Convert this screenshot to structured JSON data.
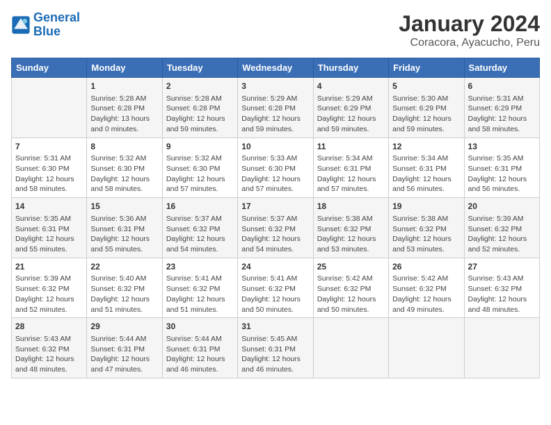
{
  "logo": {
    "text_general": "General",
    "text_blue": "Blue"
  },
  "title": "January 2024",
  "subtitle": "Coracora, Ayacucho, Peru",
  "days_of_week": [
    "Sunday",
    "Monday",
    "Tuesday",
    "Wednesday",
    "Thursday",
    "Friday",
    "Saturday"
  ],
  "weeks": [
    [
      {
        "day": "",
        "info": ""
      },
      {
        "day": "1",
        "info": "Sunrise: 5:28 AM\nSunset: 6:28 PM\nDaylight: 13 hours\nand 0 minutes."
      },
      {
        "day": "2",
        "info": "Sunrise: 5:28 AM\nSunset: 6:28 PM\nDaylight: 12 hours\nand 59 minutes."
      },
      {
        "day": "3",
        "info": "Sunrise: 5:29 AM\nSunset: 6:28 PM\nDaylight: 12 hours\nand 59 minutes."
      },
      {
        "day": "4",
        "info": "Sunrise: 5:29 AM\nSunset: 6:29 PM\nDaylight: 12 hours\nand 59 minutes."
      },
      {
        "day": "5",
        "info": "Sunrise: 5:30 AM\nSunset: 6:29 PM\nDaylight: 12 hours\nand 59 minutes."
      },
      {
        "day": "6",
        "info": "Sunrise: 5:31 AM\nSunset: 6:29 PM\nDaylight: 12 hours\nand 58 minutes."
      }
    ],
    [
      {
        "day": "7",
        "info": "Sunrise: 5:31 AM\nSunset: 6:30 PM\nDaylight: 12 hours\nand 58 minutes."
      },
      {
        "day": "8",
        "info": "Sunrise: 5:32 AM\nSunset: 6:30 PM\nDaylight: 12 hours\nand 58 minutes."
      },
      {
        "day": "9",
        "info": "Sunrise: 5:32 AM\nSunset: 6:30 PM\nDaylight: 12 hours\nand 57 minutes."
      },
      {
        "day": "10",
        "info": "Sunrise: 5:33 AM\nSunset: 6:30 PM\nDaylight: 12 hours\nand 57 minutes."
      },
      {
        "day": "11",
        "info": "Sunrise: 5:34 AM\nSunset: 6:31 PM\nDaylight: 12 hours\nand 57 minutes."
      },
      {
        "day": "12",
        "info": "Sunrise: 5:34 AM\nSunset: 6:31 PM\nDaylight: 12 hours\nand 56 minutes."
      },
      {
        "day": "13",
        "info": "Sunrise: 5:35 AM\nSunset: 6:31 PM\nDaylight: 12 hours\nand 56 minutes."
      }
    ],
    [
      {
        "day": "14",
        "info": "Sunrise: 5:35 AM\nSunset: 6:31 PM\nDaylight: 12 hours\nand 55 minutes."
      },
      {
        "day": "15",
        "info": "Sunrise: 5:36 AM\nSunset: 6:31 PM\nDaylight: 12 hours\nand 55 minutes."
      },
      {
        "day": "16",
        "info": "Sunrise: 5:37 AM\nSunset: 6:32 PM\nDaylight: 12 hours\nand 54 minutes."
      },
      {
        "day": "17",
        "info": "Sunrise: 5:37 AM\nSunset: 6:32 PM\nDaylight: 12 hours\nand 54 minutes."
      },
      {
        "day": "18",
        "info": "Sunrise: 5:38 AM\nSunset: 6:32 PM\nDaylight: 12 hours\nand 53 minutes."
      },
      {
        "day": "19",
        "info": "Sunrise: 5:38 AM\nSunset: 6:32 PM\nDaylight: 12 hours\nand 53 minutes."
      },
      {
        "day": "20",
        "info": "Sunrise: 5:39 AM\nSunset: 6:32 PM\nDaylight: 12 hours\nand 52 minutes."
      }
    ],
    [
      {
        "day": "21",
        "info": "Sunrise: 5:39 AM\nSunset: 6:32 PM\nDaylight: 12 hours\nand 52 minutes."
      },
      {
        "day": "22",
        "info": "Sunrise: 5:40 AM\nSunset: 6:32 PM\nDaylight: 12 hours\nand 51 minutes."
      },
      {
        "day": "23",
        "info": "Sunrise: 5:41 AM\nSunset: 6:32 PM\nDaylight: 12 hours\nand 51 minutes."
      },
      {
        "day": "24",
        "info": "Sunrise: 5:41 AM\nSunset: 6:32 PM\nDaylight: 12 hours\nand 50 minutes."
      },
      {
        "day": "25",
        "info": "Sunrise: 5:42 AM\nSunset: 6:32 PM\nDaylight: 12 hours\nand 50 minutes."
      },
      {
        "day": "26",
        "info": "Sunrise: 5:42 AM\nSunset: 6:32 PM\nDaylight: 12 hours\nand 49 minutes."
      },
      {
        "day": "27",
        "info": "Sunrise: 5:43 AM\nSunset: 6:32 PM\nDaylight: 12 hours\nand 48 minutes."
      }
    ],
    [
      {
        "day": "28",
        "info": "Sunrise: 5:43 AM\nSunset: 6:32 PM\nDaylight: 12 hours\nand 48 minutes."
      },
      {
        "day": "29",
        "info": "Sunrise: 5:44 AM\nSunset: 6:31 PM\nDaylight: 12 hours\nand 47 minutes."
      },
      {
        "day": "30",
        "info": "Sunrise: 5:44 AM\nSunset: 6:31 PM\nDaylight: 12 hours\nand 46 minutes."
      },
      {
        "day": "31",
        "info": "Sunrise: 5:45 AM\nSunset: 6:31 PM\nDaylight: 12 hours\nand 46 minutes."
      },
      {
        "day": "",
        "info": ""
      },
      {
        "day": "",
        "info": ""
      },
      {
        "day": "",
        "info": ""
      }
    ]
  ]
}
